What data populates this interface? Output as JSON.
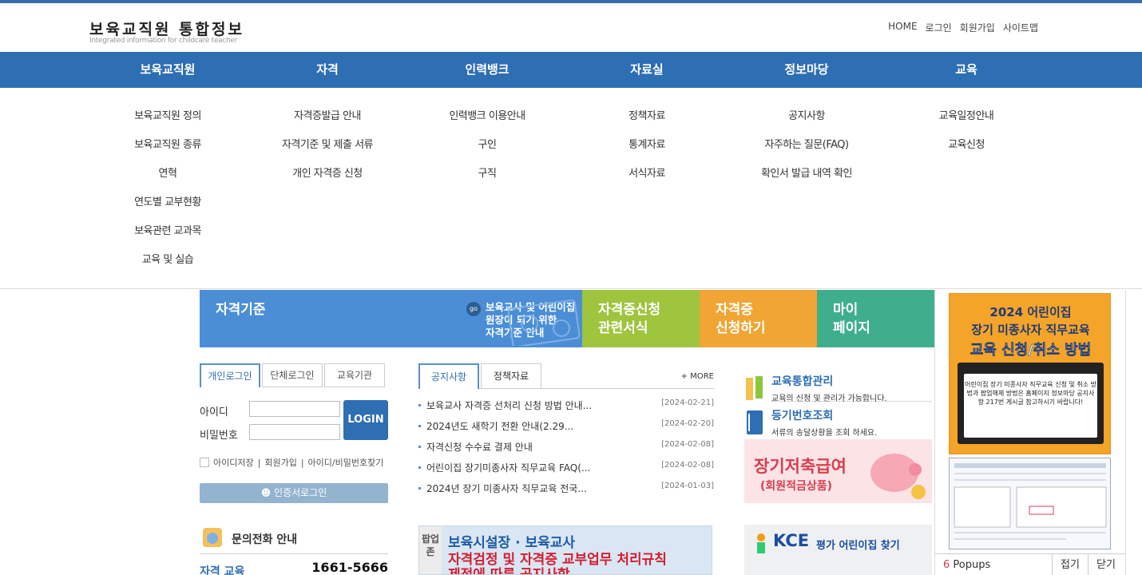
{
  "header": {
    "logo_ko": "보육교직원 통합정보",
    "logo_en": "Integrated information for childcare teacher",
    "util": [
      "HOME",
      "로그인",
      "회원가입",
      "사이트맵"
    ]
  },
  "nav": [
    {
      "label": "보육교직원",
      "sub": [
        "보육교직원 정의",
        "보육교직원 종류",
        "연혁",
        "연도별 교부현황",
        "보육관련 교과목",
        "교육 및 실습"
      ]
    },
    {
      "label": "자격",
      "sub": [
        "자격증발급 안내",
        "자격기준 및 제출 서류",
        "개인 자격증 신청"
      ]
    },
    {
      "label": "인력뱅크",
      "sub": [
        "인력뱅크 이용안내",
        "구인",
        "구직"
      ]
    },
    {
      "label": "자료실",
      "sub": [
        "정책자료",
        "통계자료",
        "서식자료"
      ]
    },
    {
      "label": "정보마당",
      "sub": [
        "공지사항",
        "자주하는 질문(FAQ)",
        "확인서 발급 내역 확인"
      ]
    },
    {
      "label": "교육",
      "sub": [
        "교육일정안내",
        "교육신청"
      ]
    }
  ],
  "banners": {
    "criteria_title": "자격기준",
    "criteria_go": "go",
    "criteria_desc1": "보육교사 및 어린이집 원장이 되기 위한",
    "criteria_desc2": "자격기준 안내",
    "forms_l1": "자격증신청",
    "forms_l2": "관련서식",
    "apply_l1": "자격증",
    "apply_l2": "신청하기",
    "mypage_l1": "마이",
    "mypage_l2": "페이지"
  },
  "login": {
    "tabs": [
      "개인로그인",
      "단체로그인",
      "교육기관"
    ],
    "id_label": "아이디",
    "pw_label": "비밀번호",
    "button": "LOGIN",
    "save_id": "아이디저장",
    "join": "회원가입",
    "find": "아이디/비밀번호찾기",
    "cert": "인증서로그인"
  },
  "inquiry": {
    "title": "문의전화 안내",
    "label": "자격 교육",
    "phone": "1661-5666"
  },
  "notice": {
    "tabs": [
      "공지사항",
      "정책자료"
    ],
    "more": "+ MORE",
    "items": [
      {
        "title": "보육교사 자격증 선처리 신청 방법 안내...",
        "date": "[2024-02-21]"
      },
      {
        "title": "2024년도 새학기 전환 안내(2.29...",
        "date": "[2024-02-20]"
      },
      {
        "title": "자격신청 수수료 결제 안내",
        "date": "[2024-02-08]"
      },
      {
        "title": "어린이집 장기미종사자 직무교육 FAQ(...",
        "date": "[2024-02-08]"
      },
      {
        "title": "2024년 장기 미종사자 직무교육 전국...",
        "date": "[2024-01-03]"
      }
    ]
  },
  "popupzone": {
    "side": "팝업존",
    "line1": "보육시설장 · 보육교사",
    "line2": "자격검정 및 자격증 교부업무 처리규칙",
    "line3": "제정에 따른 공지사항"
  },
  "services": {
    "edu_name": "교육통합관리",
    "edu_desc": "교육의 신청 및 관리가 가능합니다.",
    "reg_name": "등기번호조회",
    "reg_desc": "서류의 송달상황을 조회 하세요.",
    "pig_a": "장기저축급여",
    "pig_b": "(회원적금상품)",
    "kce_logo": "KCE",
    "kce_text": "평가 어린이집 찾기"
  },
  "popups": {
    "poster_l1": "2024 어린이집",
    "poster_l2": "장기 미종사자 직무교육",
    "poster_l3": "교육 신청/취소 방법",
    "poster_box": "어린이집 장기 미종사자 직무교육 신청 및 취소 방법과 팝업해제 방법은 홈페이지 정보마당 공지사항 217번 게시글 참고하시기 바랍니다!",
    "count": "6",
    "count_label": "Popups",
    "prev": "접기",
    "close": "닫기"
  }
}
